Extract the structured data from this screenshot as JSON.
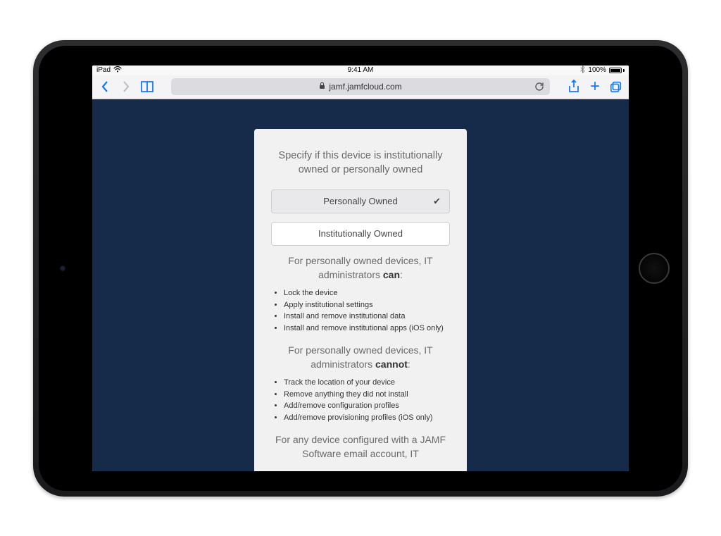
{
  "status": {
    "carrier": "iPad",
    "time": "9:41 AM",
    "battery_pct": "100%"
  },
  "browser": {
    "url_display": "jamf.jamfcloud.com"
  },
  "card": {
    "prompt": "Specify if this device is institutionally owned or personally owned",
    "option_personal": "Personally Owned",
    "option_institutional": "Institutionally Owned",
    "can_head_prefix": "For personally owned devices, IT administrators ",
    "can_word": "can",
    "can_head_suffix": ":",
    "can_items": [
      "Lock the device",
      "Apply institutional settings",
      "Install and remove institutional data",
      "Install and remove institutional apps (iOS only)"
    ],
    "cannot_head_prefix": "For personally owned devices, IT administrators ",
    "cannot_word": "cannot",
    "cannot_head_suffix": ":",
    "cannot_items": [
      "Track the location of your device",
      "Remove anything they did not install",
      "Add/remove configuration profiles",
      "Add/remove provisioning profiles (iOS only)"
    ],
    "footer_text": "For any device configured with a JAMF Software email account, IT"
  }
}
